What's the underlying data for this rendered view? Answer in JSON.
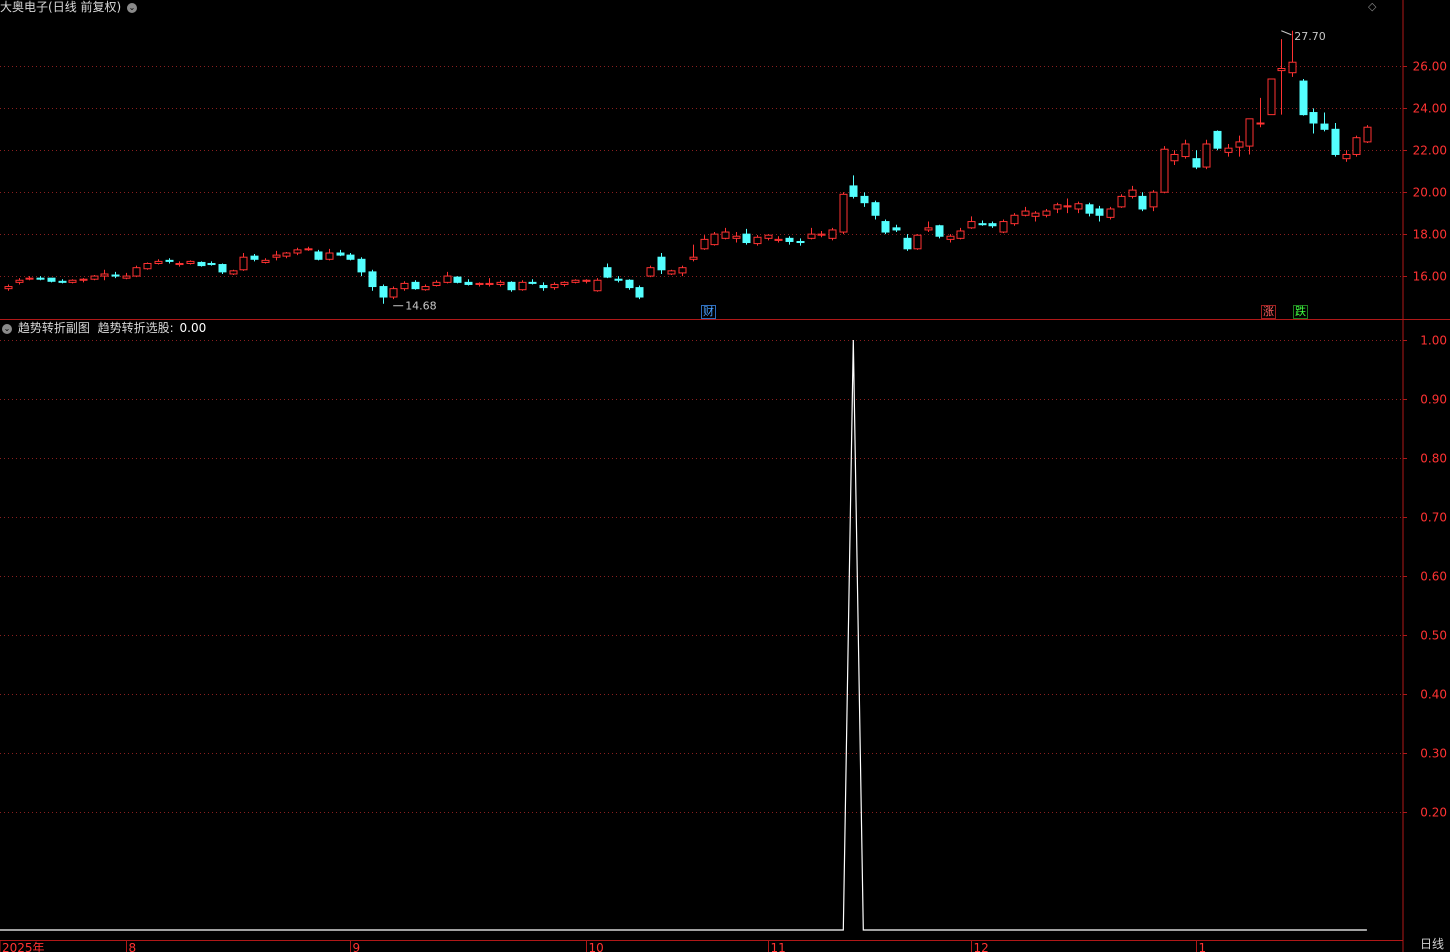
{
  "header": {
    "stock_name": "大奥电子",
    "period_mode": "(日线 前复权)",
    "dropdown_icon": "chevron-down-icon"
  },
  "sub_header": {
    "icon": "circle-indicator-icon",
    "indicator_name": "趋势转折副图",
    "series_label": "趋势转折选股:",
    "series_value": "0.00"
  },
  "badges": {
    "finance": "财",
    "limit_up": "涨",
    "limit_down": "跌"
  },
  "period_tag": "日线",
  "colors": {
    "up": "#ff3232",
    "down": "#54ffff",
    "grid": "#8a1f1f",
    "axis": "#b01818",
    "line": "#ffffff"
  },
  "chart_data": [
    {
      "type": "candlestick",
      "ylim": [
        14.0,
        28.5
      ],
      "yticks": [
        16,
        18,
        20,
        22,
        24,
        26
      ],
      "ytick_labels": [
        "16.00",
        "18.00",
        "20.00",
        "22.00",
        "24.00",
        "26.00"
      ],
      "grid": true,
      "annotations": [
        {
          "text": "14.68",
          "index": 36,
          "value": 14.68,
          "type": "low"
        },
        {
          "text": "27.70",
          "index": 119,
          "value": 27.7,
          "type": "high"
        }
      ],
      "ohlc": [
        [
          15.4,
          15.6,
          15.3,
          15.5
        ],
        [
          15.7,
          15.9,
          15.6,
          15.8
        ],
        [
          15.9,
          16.0,
          15.8,
          15.9
        ],
        [
          15.9,
          16.0,
          15.8,
          15.85
        ],
        [
          15.9,
          15.9,
          15.7,
          15.75
        ],
        [
          15.75,
          15.85,
          15.65,
          15.7
        ],
        [
          15.7,
          15.85,
          15.65,
          15.8
        ],
        [
          15.8,
          15.9,
          15.7,
          15.85
        ],
        [
          15.85,
          16.05,
          15.8,
          16.0
        ],
        [
          16.0,
          16.3,
          15.8,
          16.1
        ],
        [
          16.05,
          16.2,
          15.9,
          16.0
        ],
        [
          15.9,
          16.15,
          15.85,
          16.0
        ],
        [
          16.0,
          16.5,
          15.95,
          16.4
        ],
        [
          16.35,
          16.65,
          16.3,
          16.6
        ],
        [
          16.6,
          16.8,
          16.55,
          16.7
        ],
        [
          16.75,
          16.85,
          16.6,
          16.7
        ],
        [
          16.55,
          16.7,
          16.45,
          16.6
        ],
        [
          16.6,
          16.75,
          16.55,
          16.7
        ],
        [
          16.65,
          16.7,
          16.45,
          16.5
        ],
        [
          16.6,
          16.7,
          16.5,
          16.55
        ],
        [
          16.55,
          16.6,
          16.1,
          16.2
        ],
        [
          16.1,
          16.3,
          16.05,
          16.25
        ],
        [
          16.3,
          17.1,
          16.25,
          16.9
        ],
        [
          16.95,
          17.05,
          16.7,
          16.8
        ],
        [
          16.65,
          16.85,
          16.6,
          16.75
        ],
        [
          16.9,
          17.2,
          16.75,
          17.0
        ],
        [
          16.95,
          17.15,
          16.85,
          17.1
        ],
        [
          17.1,
          17.35,
          17.0,
          17.25
        ],
        [
          17.3,
          17.4,
          17.2,
          17.3
        ],
        [
          17.15,
          17.25,
          16.75,
          16.8
        ],
        [
          16.8,
          17.3,
          16.75,
          17.1
        ],
        [
          17.1,
          17.25,
          16.95,
          17.0
        ],
        [
          17.0,
          17.1,
          16.75,
          16.8
        ],
        [
          16.8,
          16.9,
          16.0,
          16.2
        ],
        [
          16.2,
          16.3,
          15.3,
          15.5
        ],
        [
          15.5,
          15.6,
          14.68,
          15.0
        ],
        [
          15.0,
          15.5,
          14.9,
          15.4
        ],
        [
          15.4,
          15.75,
          15.3,
          15.65
        ],
        [
          15.7,
          15.8,
          15.35,
          15.4
        ],
        [
          15.35,
          15.6,
          15.3,
          15.5
        ],
        [
          15.55,
          15.8,
          15.5,
          15.7
        ],
        [
          15.7,
          16.2,
          15.65,
          16.0
        ],
        [
          15.95,
          16.0,
          15.65,
          15.7
        ],
        [
          15.7,
          15.85,
          15.55,
          15.6
        ],
        [
          15.6,
          15.7,
          15.5,
          15.65
        ],
        [
          15.6,
          15.9,
          15.5,
          15.65
        ],
        [
          15.6,
          15.8,
          15.5,
          15.7
        ],
        [
          15.7,
          15.75,
          15.25,
          15.35
        ],
        [
          15.35,
          15.8,
          15.3,
          15.7
        ],
        [
          15.7,
          15.85,
          15.6,
          15.65
        ],
        [
          15.55,
          15.7,
          15.3,
          15.45
        ],
        [
          15.45,
          15.7,
          15.35,
          15.6
        ],
        [
          15.6,
          15.75,
          15.5,
          15.7
        ],
        [
          15.7,
          15.85,
          15.65,
          15.8
        ],
        [
          15.75,
          15.85,
          15.65,
          15.8
        ],
        [
          15.3,
          15.9,
          15.25,
          15.8
        ],
        [
          16.4,
          16.6,
          15.9,
          15.95
        ],
        [
          15.85,
          16.0,
          15.7,
          15.8
        ],
        [
          15.8,
          15.85,
          15.35,
          15.45
        ],
        [
          15.45,
          15.55,
          14.9,
          15.0
        ],
        [
          16.0,
          16.5,
          15.95,
          16.4
        ],
        [
          16.9,
          17.1,
          16.1,
          16.3
        ],
        [
          16.1,
          16.3,
          16.05,
          16.25
        ],
        [
          16.15,
          16.5,
          16.0,
          16.4
        ],
        [
          16.8,
          17.5,
          16.7,
          16.9
        ],
        [
          17.3,
          17.95,
          17.25,
          17.75
        ],
        [
          17.5,
          18.1,
          17.45,
          18.0
        ],
        [
          17.8,
          18.3,
          17.75,
          18.1
        ],
        [
          17.8,
          18.1,
          17.6,
          17.9
        ],
        [
          18.0,
          18.25,
          17.5,
          17.6
        ],
        [
          17.55,
          17.95,
          17.45,
          17.85
        ],
        [
          17.8,
          18.0,
          17.7,
          17.95
        ],
        [
          17.7,
          17.9,
          17.6,
          17.75
        ],
        [
          17.8,
          17.9,
          17.5,
          17.65
        ],
        [
          17.65,
          17.8,
          17.45,
          17.6
        ],
        [
          17.8,
          18.3,
          17.75,
          18.0
        ],
        [
          17.95,
          18.15,
          17.85,
          18.0
        ],
        [
          17.8,
          18.3,
          17.7,
          18.2
        ],
        [
          18.1,
          20.0,
          18.0,
          19.9
        ],
        [
          20.3,
          20.8,
          19.7,
          19.8
        ],
        [
          19.8,
          20.0,
          19.3,
          19.5
        ],
        [
          19.5,
          19.6,
          18.7,
          18.9
        ],
        [
          18.6,
          18.7,
          18.0,
          18.1
        ],
        [
          18.3,
          18.45,
          18.1,
          18.2
        ],
        [
          17.8,
          18.0,
          17.2,
          17.3
        ],
        [
          17.3,
          18.0,
          17.25,
          17.95
        ],
        [
          18.2,
          18.6,
          18.1,
          18.3
        ],
        [
          18.4,
          18.45,
          17.8,
          17.9
        ],
        [
          17.75,
          18.0,
          17.6,
          17.9
        ],
        [
          17.8,
          18.3,
          17.75,
          18.15
        ],
        [
          18.3,
          18.85,
          18.25,
          18.6
        ],
        [
          18.5,
          18.65,
          18.4,
          18.45
        ],
        [
          18.5,
          18.6,
          18.3,
          18.4
        ],
        [
          18.1,
          18.7,
          18.05,
          18.6
        ],
        [
          18.5,
          19.0,
          18.4,
          18.9
        ],
        [
          18.9,
          19.3,
          18.85,
          19.1
        ],
        [
          18.85,
          19.1,
          18.6,
          19.0
        ],
        [
          18.9,
          19.2,
          18.8,
          19.1
        ],
        [
          19.2,
          19.5,
          19.0,
          19.4
        ],
        [
          19.3,
          19.7,
          19.0,
          19.35
        ],
        [
          19.2,
          19.55,
          19.0,
          19.45
        ],
        [
          19.4,
          19.5,
          18.85,
          19.0
        ],
        [
          19.2,
          19.35,
          18.6,
          18.9
        ],
        [
          18.8,
          19.3,
          18.7,
          19.2
        ],
        [
          19.3,
          19.9,
          19.25,
          19.8
        ],
        [
          19.8,
          20.3,
          19.7,
          20.1
        ],
        [
          19.8,
          20.0,
          19.1,
          19.2
        ],
        [
          19.3,
          20.1,
          19.1,
          20.0
        ],
        [
          20.0,
          22.2,
          19.95,
          22.05
        ],
        [
          21.5,
          22.0,
          21.3,
          21.8
        ],
        [
          21.7,
          22.5,
          21.6,
          22.3
        ],
        [
          21.6,
          22.0,
          21.1,
          21.2
        ],
        [
          21.2,
          22.5,
          21.1,
          22.3
        ],
        [
          22.9,
          22.95,
          22.0,
          22.1
        ],
        [
          21.9,
          22.3,
          21.7,
          22.1
        ],
        [
          22.15,
          22.7,
          21.7,
          22.4
        ],
        [
          22.2,
          23.5,
          21.8,
          23.5
        ],
        [
          23.3,
          24.5,
          23.1,
          23.3
        ],
        [
          23.7,
          25.4,
          23.7,
          25.4
        ],
        [
          25.8,
          27.3,
          23.7,
          25.9
        ],
        [
          25.7,
          27.7,
          25.5,
          26.2
        ],
        [
          25.3,
          25.4,
          23.65,
          23.7
        ],
        [
          23.8,
          24.0,
          22.8,
          23.3
        ],
        [
          23.25,
          23.8,
          22.9,
          23.0
        ],
        [
          23.0,
          23.3,
          21.7,
          21.8
        ],
        [
          21.6,
          22.0,
          21.45,
          21.8
        ],
        [
          21.8,
          22.7,
          21.7,
          22.6
        ],
        [
          22.4,
          23.2,
          22.35,
          23.1
        ]
      ],
      "time_axis_labels": [
        "2025年",
        "8",
        "9",
        "10",
        "11",
        "12",
        "1"
      ],
      "time_axis_index": [
        0,
        11,
        32,
        54,
        71,
        90,
        111
      ]
    },
    {
      "type": "line",
      "name": "趋势转折选股",
      "ylim": [
        0,
        1.0
      ],
      "yticks": [
        0.2,
        0.3,
        0.4,
        0.5,
        0.6,
        0.7,
        0.8,
        0.9,
        1.0
      ],
      "ytick_labels": [
        "0.20",
        "0.30",
        "0.40",
        "0.50",
        "0.60",
        "0.70",
        "0.80",
        "0.90",
        "1.00"
      ],
      "grid": true,
      "signal_index": 79,
      "values_note_index_range": [
        0,
        124
      ]
    }
  ]
}
